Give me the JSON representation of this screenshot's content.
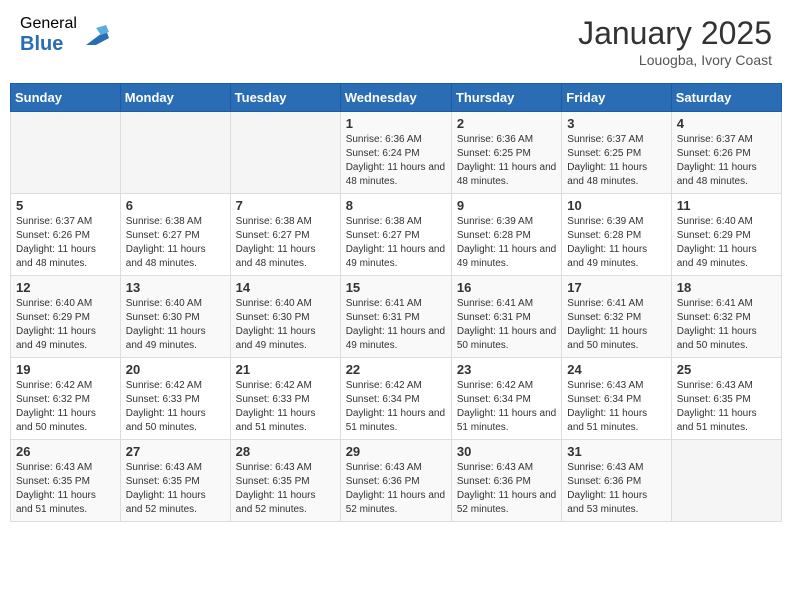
{
  "header": {
    "logo_general": "General",
    "logo_blue": "Blue",
    "month_title": "January 2025",
    "location": "Louogba, Ivory Coast"
  },
  "days_of_week": [
    "Sunday",
    "Monday",
    "Tuesday",
    "Wednesday",
    "Thursday",
    "Friday",
    "Saturday"
  ],
  "weeks": [
    [
      {
        "day": "",
        "info": ""
      },
      {
        "day": "",
        "info": ""
      },
      {
        "day": "",
        "info": ""
      },
      {
        "day": "1",
        "info": "Sunrise: 6:36 AM\nSunset: 6:24 PM\nDaylight: 11 hours and 48 minutes."
      },
      {
        "day": "2",
        "info": "Sunrise: 6:36 AM\nSunset: 6:25 PM\nDaylight: 11 hours and 48 minutes."
      },
      {
        "day": "3",
        "info": "Sunrise: 6:37 AM\nSunset: 6:25 PM\nDaylight: 11 hours and 48 minutes."
      },
      {
        "day": "4",
        "info": "Sunrise: 6:37 AM\nSunset: 6:26 PM\nDaylight: 11 hours and 48 minutes."
      }
    ],
    [
      {
        "day": "5",
        "info": "Sunrise: 6:37 AM\nSunset: 6:26 PM\nDaylight: 11 hours and 48 minutes."
      },
      {
        "day": "6",
        "info": "Sunrise: 6:38 AM\nSunset: 6:27 PM\nDaylight: 11 hours and 48 minutes."
      },
      {
        "day": "7",
        "info": "Sunrise: 6:38 AM\nSunset: 6:27 PM\nDaylight: 11 hours and 48 minutes."
      },
      {
        "day": "8",
        "info": "Sunrise: 6:38 AM\nSunset: 6:27 PM\nDaylight: 11 hours and 49 minutes."
      },
      {
        "day": "9",
        "info": "Sunrise: 6:39 AM\nSunset: 6:28 PM\nDaylight: 11 hours and 49 minutes."
      },
      {
        "day": "10",
        "info": "Sunrise: 6:39 AM\nSunset: 6:28 PM\nDaylight: 11 hours and 49 minutes."
      },
      {
        "day": "11",
        "info": "Sunrise: 6:40 AM\nSunset: 6:29 PM\nDaylight: 11 hours and 49 minutes."
      }
    ],
    [
      {
        "day": "12",
        "info": "Sunrise: 6:40 AM\nSunset: 6:29 PM\nDaylight: 11 hours and 49 minutes."
      },
      {
        "day": "13",
        "info": "Sunrise: 6:40 AM\nSunset: 6:30 PM\nDaylight: 11 hours and 49 minutes."
      },
      {
        "day": "14",
        "info": "Sunrise: 6:40 AM\nSunset: 6:30 PM\nDaylight: 11 hours and 49 minutes."
      },
      {
        "day": "15",
        "info": "Sunrise: 6:41 AM\nSunset: 6:31 PM\nDaylight: 11 hours and 49 minutes."
      },
      {
        "day": "16",
        "info": "Sunrise: 6:41 AM\nSunset: 6:31 PM\nDaylight: 11 hours and 50 minutes."
      },
      {
        "day": "17",
        "info": "Sunrise: 6:41 AM\nSunset: 6:32 PM\nDaylight: 11 hours and 50 minutes."
      },
      {
        "day": "18",
        "info": "Sunrise: 6:41 AM\nSunset: 6:32 PM\nDaylight: 11 hours and 50 minutes."
      }
    ],
    [
      {
        "day": "19",
        "info": "Sunrise: 6:42 AM\nSunset: 6:32 PM\nDaylight: 11 hours and 50 minutes."
      },
      {
        "day": "20",
        "info": "Sunrise: 6:42 AM\nSunset: 6:33 PM\nDaylight: 11 hours and 50 minutes."
      },
      {
        "day": "21",
        "info": "Sunrise: 6:42 AM\nSunset: 6:33 PM\nDaylight: 11 hours and 51 minutes."
      },
      {
        "day": "22",
        "info": "Sunrise: 6:42 AM\nSunset: 6:34 PM\nDaylight: 11 hours and 51 minutes."
      },
      {
        "day": "23",
        "info": "Sunrise: 6:42 AM\nSunset: 6:34 PM\nDaylight: 11 hours and 51 minutes."
      },
      {
        "day": "24",
        "info": "Sunrise: 6:43 AM\nSunset: 6:34 PM\nDaylight: 11 hours and 51 minutes."
      },
      {
        "day": "25",
        "info": "Sunrise: 6:43 AM\nSunset: 6:35 PM\nDaylight: 11 hours and 51 minutes."
      }
    ],
    [
      {
        "day": "26",
        "info": "Sunrise: 6:43 AM\nSunset: 6:35 PM\nDaylight: 11 hours and 51 minutes."
      },
      {
        "day": "27",
        "info": "Sunrise: 6:43 AM\nSunset: 6:35 PM\nDaylight: 11 hours and 52 minutes."
      },
      {
        "day": "28",
        "info": "Sunrise: 6:43 AM\nSunset: 6:35 PM\nDaylight: 11 hours and 52 minutes."
      },
      {
        "day": "29",
        "info": "Sunrise: 6:43 AM\nSunset: 6:36 PM\nDaylight: 11 hours and 52 minutes."
      },
      {
        "day": "30",
        "info": "Sunrise: 6:43 AM\nSunset: 6:36 PM\nDaylight: 11 hours and 52 minutes."
      },
      {
        "day": "31",
        "info": "Sunrise: 6:43 AM\nSunset: 6:36 PM\nDaylight: 11 hours and 53 minutes."
      },
      {
        "day": "",
        "info": ""
      }
    ]
  ]
}
